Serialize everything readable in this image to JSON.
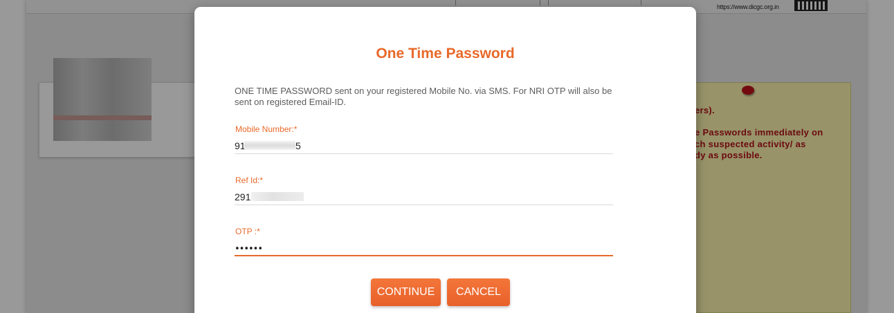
{
  "background": {
    "url_text": "https://www.dicgc.org.in",
    "notice_lines": [
      "ers).",
      "e Passwords immediately on",
      "ch  suspected  activity/  as",
      "dy as possible."
    ]
  },
  "modal": {
    "title": "One Time Password",
    "info": "ONE TIME PASSWORD sent on your registered Mobile No. via SMS. For NRI OTP will also be sent on registered Email-ID.",
    "fields": {
      "mobile": {
        "label": "Mobile Number:*",
        "value_prefix": "91",
        "value_suffix": "5"
      },
      "ref_id": {
        "label": "Ref Id:*",
        "value_prefix": "291"
      },
      "otp": {
        "label": "OTP :*",
        "value": "••••••"
      }
    },
    "buttons": {
      "continue": "CONTINUE",
      "cancel": "CANCEL"
    }
  },
  "colors": {
    "accent": "#e8692a",
    "notice_bg": "#fdf5b0",
    "notice_text": "#b3121b"
  }
}
